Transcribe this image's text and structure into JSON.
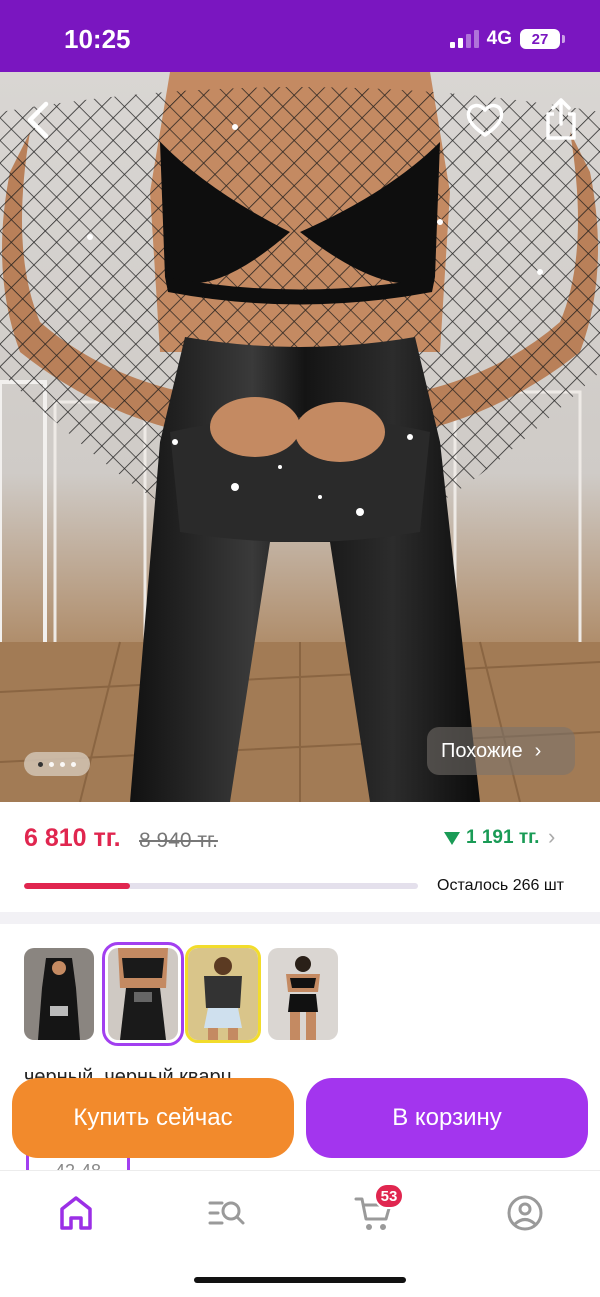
{
  "status_bar": {
    "time": "10:25",
    "network": "4G",
    "battery": "27"
  },
  "hero": {
    "similar_label": "Похожие",
    "dots_count": 4,
    "active_dot": 1
  },
  "price": {
    "current": "6 810 тг.",
    "old": "8 940 тг.",
    "saving": "1 191 тг.",
    "stock_text": "Осталось 266 шт",
    "stock_fill_fraction": 0.27
  },
  "variants": {
    "color_label": "черный, черный кварц",
    "selected_index": 1,
    "size_label": "42-48"
  },
  "actions": {
    "buy_now": "Купить сейчас",
    "add_to_cart": "В корзину"
  },
  "nav": {
    "cart_badge": "53"
  },
  "colors": {
    "brand": "#7a16c0",
    "accent": "#a335ee",
    "price": "#e0264f",
    "buy": "#f28a2c",
    "saving": "#1a9b56"
  },
  "icons": [
    "back-icon",
    "heart-icon",
    "share-icon",
    "home-icon",
    "catalog-search-icon",
    "cart-icon",
    "profile-icon"
  ]
}
